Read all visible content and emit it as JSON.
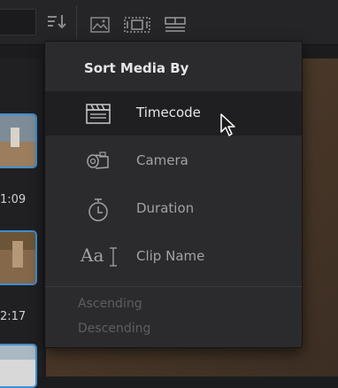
{
  "toolbar": {
    "sort_icon": "sort-down-icon",
    "view_icons": [
      "thumbnail-view-icon",
      "filmstrip-view-icon",
      "list-view-icon"
    ]
  },
  "clips": [
    {
      "timecode": "1:09",
      "thumb_colors": [
        "#5a6e7e",
        "#9a7a5c"
      ]
    },
    {
      "timecode": "2:17",
      "thumb_colors": [
        "#6b5536",
        "#5c4a2c"
      ]
    },
    {
      "timecode": "",
      "thumb_colors": [
        "#8aa0b0",
        "#c8c8c8"
      ]
    }
  ],
  "menu": {
    "title": "Sort Media By",
    "items": [
      {
        "label": "Timecode",
        "icon": "clapperboard-icon",
        "enabled": true,
        "active": true
      },
      {
        "label": "Camera",
        "icon": "camera-icon",
        "enabled": true,
        "active": false
      },
      {
        "label": "Duration",
        "icon": "stopwatch-icon",
        "enabled": true,
        "active": false
      },
      {
        "label": "Clip Name",
        "icon": "text-cursor-icon",
        "icon_text": "Aa",
        "enabled": true,
        "active": false
      }
    ],
    "order": [
      {
        "label": "Ascending",
        "enabled": false
      },
      {
        "label": "Descending",
        "enabled": false
      }
    ]
  },
  "colors": {
    "accent": "#3f8fd0",
    "menu_bg": "#2b2b2d",
    "active_bg": "#1f1f21",
    "text_primary": "#e6e6e8",
    "text_secondary": "#a2a2a4",
    "text_disabled": "#5e5e60"
  }
}
